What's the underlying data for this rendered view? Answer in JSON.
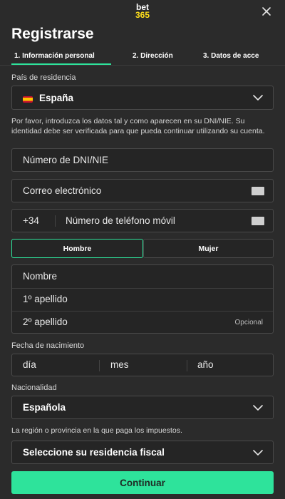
{
  "brand": {
    "line1": "bet",
    "line2": "365"
  },
  "title": "Registrarse",
  "steps": [
    {
      "label": "1. Información personal"
    },
    {
      "label": "2. Dirección"
    },
    {
      "label": "3. Datos de acce"
    }
  ],
  "country": {
    "label": "País de residencia",
    "value": "España"
  },
  "identity_help": "Por favor, introduzca los datos tal y como aparecen en su DNI/NIE. Su identidad debe ser verificada para que pueda continuar utilizando su cuenta.",
  "dni_placeholder": "Número de DNI/NIE",
  "email_placeholder": "Correo electrónico",
  "phone": {
    "prefix": "+34",
    "placeholder": "Número de teléfono móvil"
  },
  "gender": {
    "male": "Hombre",
    "female": "Mujer",
    "selected": "Hombre"
  },
  "name_fields": {
    "first": "Nombre",
    "surname1": "1º apellido",
    "surname2": "2º apellido",
    "optional": "Opcional"
  },
  "dob": {
    "label": "Fecha de nacimiento",
    "day": "día",
    "month": "mes",
    "year": "año"
  },
  "nationality": {
    "label": "Nacionalidad",
    "value": "Española"
  },
  "tax_help": "La región o provincia en la que paga los impuestos.",
  "tax_select": "Seleccione su residencia fiscal",
  "continue_label": "Continuar",
  "colors": {
    "accent": "#2ee39b",
    "brand_yellow": "#ffdf1b",
    "background": "#2b2b2b"
  }
}
